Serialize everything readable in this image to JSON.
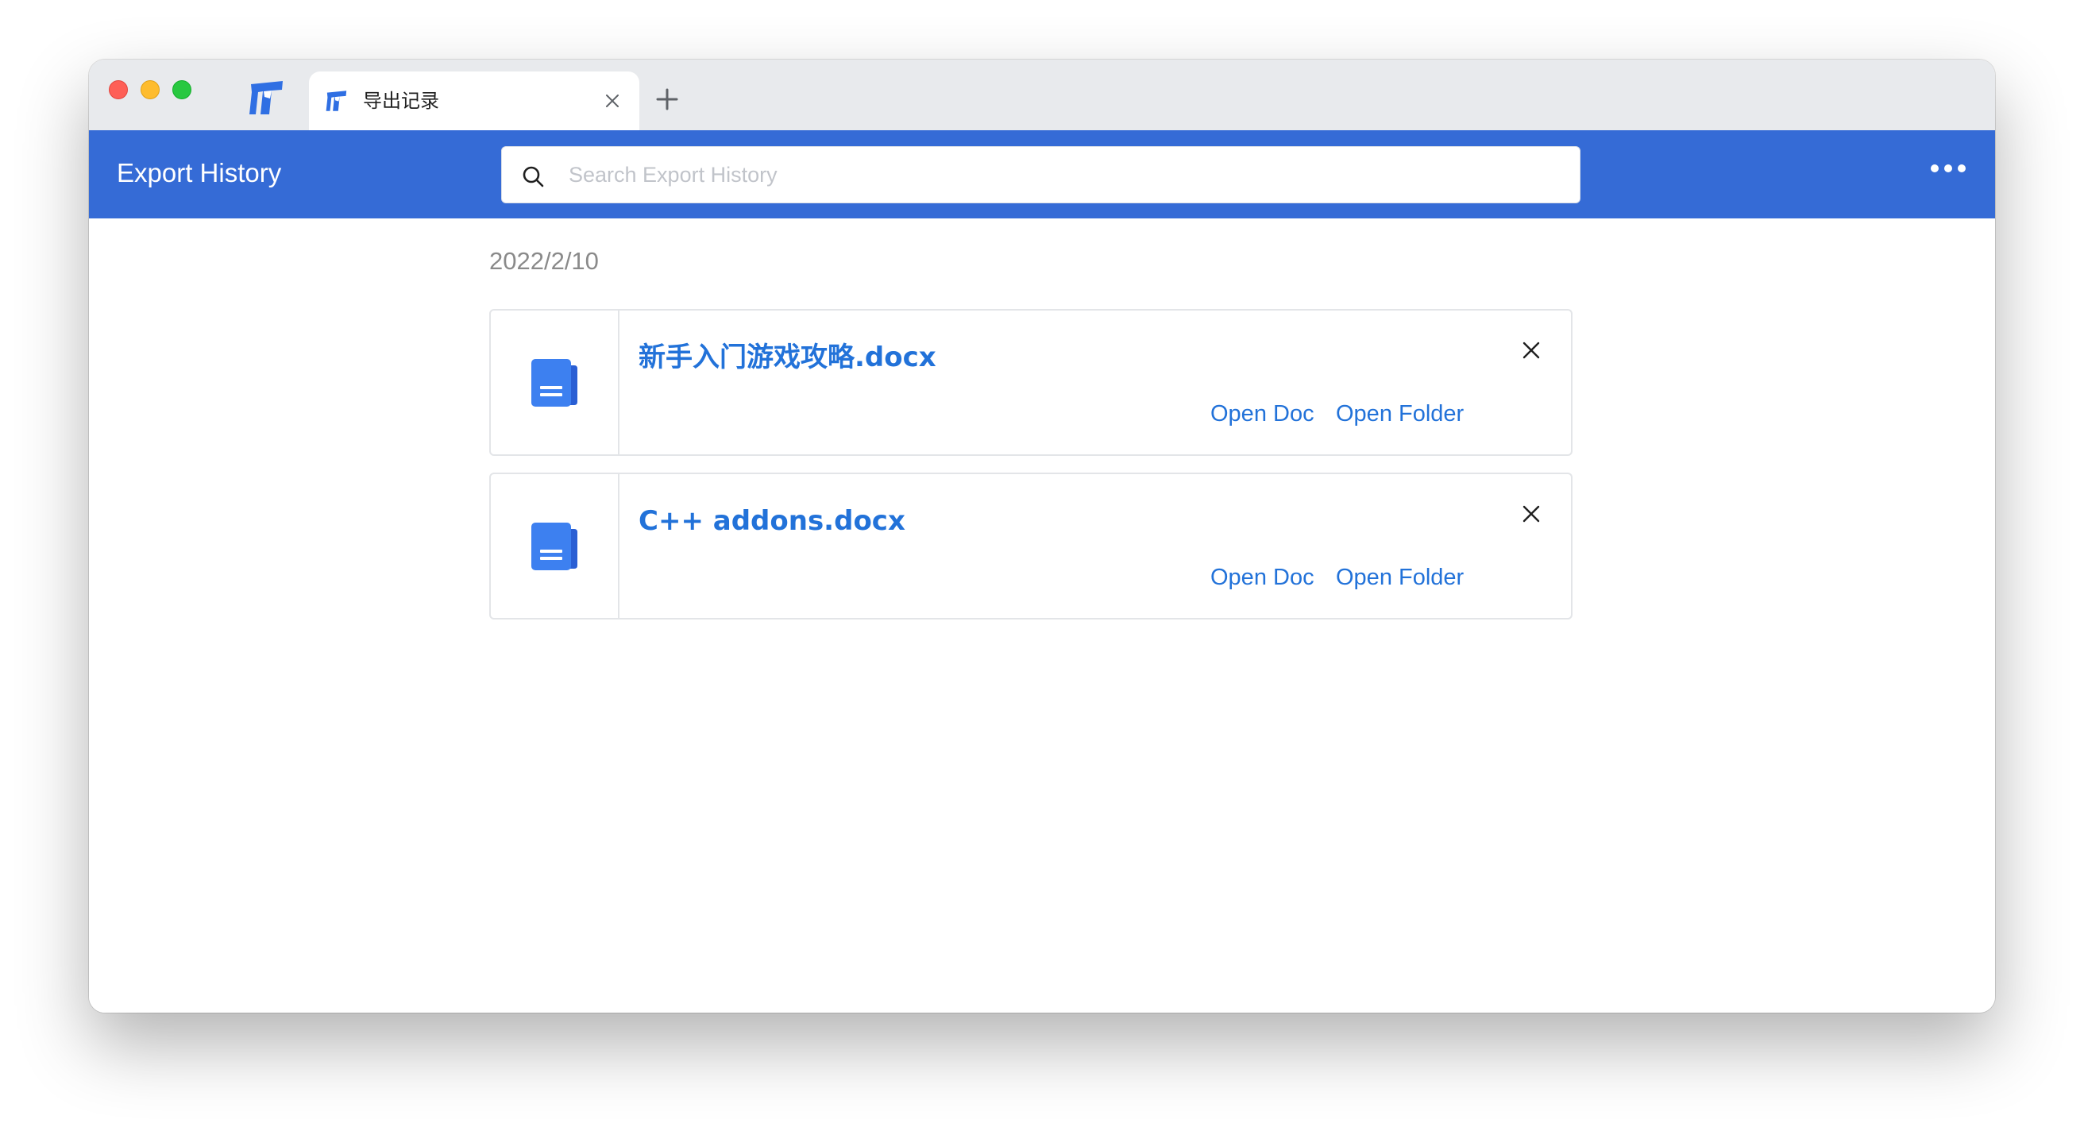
{
  "tab": {
    "title": "导出记录"
  },
  "header": {
    "title": "Export History"
  },
  "search": {
    "placeholder": "Search Export History",
    "value": ""
  },
  "history": {
    "date": "2022/2/10",
    "items": [
      {
        "filename": "新手入门游戏攻略.docx",
        "open_doc_label": "Open Doc",
        "open_folder_label": "Open Folder"
      },
      {
        "filename": "C++ addons.docx",
        "open_doc_label": "Open Doc",
        "open_folder_label": "Open Folder"
      }
    ]
  },
  "icons": {
    "app_logo": "app-logo-icon",
    "tab_icon": "app-logo-icon",
    "tab_close": "close-icon",
    "new_tab": "plus-icon",
    "search": "search-icon",
    "more": "more-horizontal-icon",
    "document": "document-icon",
    "remove_item": "close-icon"
  },
  "colors": {
    "header_bg": "#356bd6",
    "link": "#2272d9",
    "tabbar_bg": "#e8eaed",
    "date_text": "#8a8a8a",
    "doc_icon": "#3d80f0"
  }
}
